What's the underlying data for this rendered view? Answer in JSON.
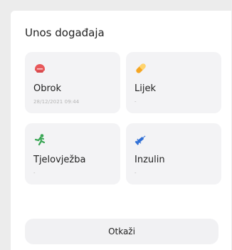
{
  "dialog": {
    "title": "Unos događaja"
  },
  "tiles": [
    {
      "label": "Obrok",
      "sub": "28/12/2021 09:44",
      "icon": "meal-icon",
      "color": "#e8585a"
    },
    {
      "label": "Lijek",
      "sub": "-",
      "icon": "pill-icon",
      "color": "#f5a623"
    },
    {
      "label": "Tjelovježba",
      "sub": "-",
      "icon": "exercise-icon",
      "color": "#3aa655"
    },
    {
      "label": "Inzulin",
      "sub": "-",
      "icon": "insulin-icon",
      "color": "#2f6fd6"
    }
  ],
  "actions": {
    "cancel_label": "Otkaži"
  }
}
